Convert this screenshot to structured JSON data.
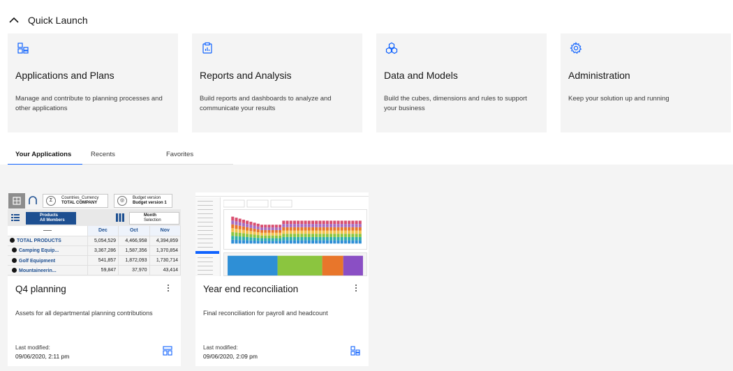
{
  "quick_launch": {
    "title": "Quick Launch",
    "tiles": [
      {
        "icon": "applications-icon",
        "title": "Applications and Plans",
        "description": "Manage and contribute to planning processes and other applications"
      },
      {
        "icon": "report-icon",
        "title": "Reports and Analysis",
        "description": "Build reports and dashboards to analyze and communicate your results"
      },
      {
        "icon": "cubes-icon",
        "title": "Data and Models",
        "description": "Build the cubes, dimensions and rules to support your business"
      },
      {
        "icon": "gear-icon",
        "title": "Administration",
        "description": "Keep your solution up and running"
      }
    ]
  },
  "tabs": [
    {
      "label": "Your Applications",
      "active": true
    },
    {
      "label": "Recents",
      "active": false
    },
    {
      "label": "Favorites",
      "active": false
    }
  ],
  "cards": [
    {
      "title": "Q4 planning",
      "description": "Assets for all departmental planning contributions",
      "modified_label": "Last modified:",
      "modified_date": "09/06/2020, 2:11 pm",
      "icon": "plan-layout-icon",
      "thumbnail": {
        "chips": [
          {
            "symbol": "Σ",
            "line1": "Countries_Currency",
            "line2": "TOTAL COMPANY"
          },
          {
            "symbol": "◎",
            "line1": "Budget version",
            "line2": "Budget version 1"
          }
        ],
        "products_chip": {
          "line1": "Products",
          "line2": "All Members"
        },
        "month_chip": {
          "line1": "Month",
          "line2": "Selection"
        },
        "columns": [
          "Dec",
          "Oct",
          "Nov"
        ],
        "rows": [
          {
            "label": "TOTAL PRODUCTS",
            "values": [
              "5,054,529",
              "4,466,958",
              "4,394,859"
            ]
          },
          {
            "label": "Camping Equip...",
            "values": [
              "3,367,286",
              "1,587,356",
              "1,370,854"
            ]
          },
          {
            "label": "Golf Equipment",
            "values": [
              "541,857",
              "1,872,093",
              "1,730,714"
            ]
          },
          {
            "label": "Mountaineerin...",
            "values": [
              "59,847",
              "37,970",
              "43,414"
            ]
          }
        ]
      }
    },
    {
      "title": "Year end reconciliation",
      "description": "Final reconciliation for payroll and headcount",
      "modified_label": "Last modified:",
      "modified_date": "09/06/2020, 2:09 pm",
      "icon": "applications-icon"
    }
  ],
  "colors": {
    "accent": "#0f62fe",
    "tile_bg": "#f4f4f4",
    "treemap": [
      "#2e8fd6",
      "#8bc53f",
      "#e8762b",
      "#8a4fc4"
    ]
  }
}
